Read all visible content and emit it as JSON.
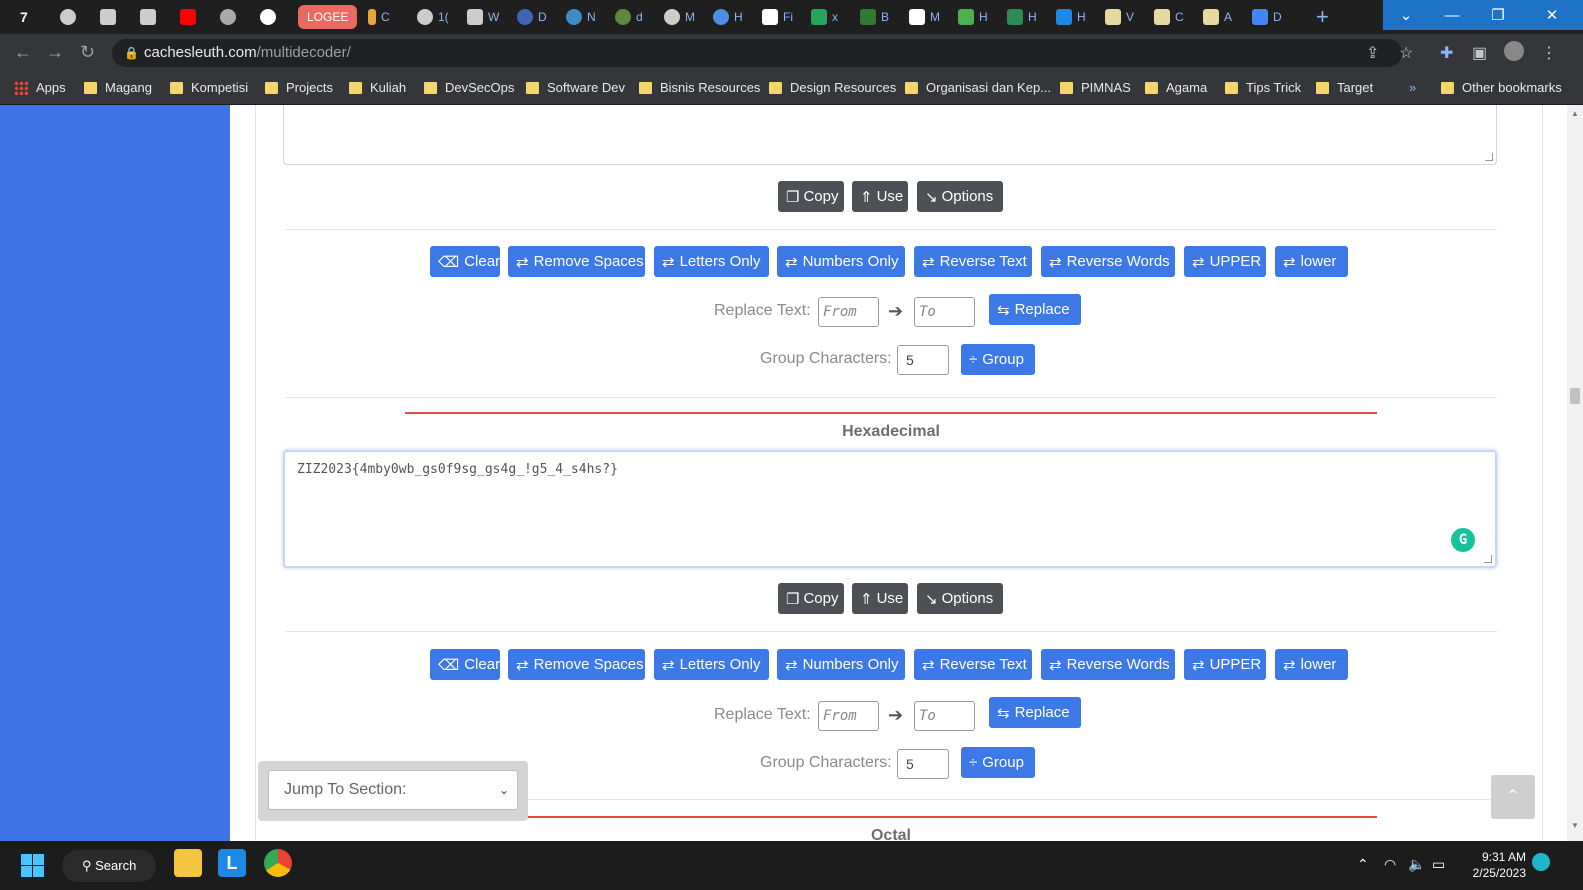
{
  "browser": {
    "tabs": [
      {
        "label": "7",
        "color": "#ffffff"
      },
      {
        "label": "",
        "color": "#cccccc"
      },
      {
        "label": "",
        "color": "#cccccc"
      },
      {
        "label": "",
        "color": "#cccccc"
      },
      {
        "label": "",
        "color": "#ff0000"
      },
      {
        "label": "",
        "color": "#aaaaaa"
      },
      {
        "label": "",
        "color": "#ffffff"
      },
      {
        "label": "LOGEE",
        "color": "#e96a61"
      },
      {
        "label": "C",
        "color": "#e8a33d"
      },
      {
        "label": "1(",
        "color": "#cccccc"
      },
      {
        "label": "W",
        "color": "#cccccc"
      },
      {
        "label": "D",
        "color": "#3c66b4"
      },
      {
        "label": "N",
        "color": "#3c8ccb"
      },
      {
        "label": "d",
        "color": "#5b8a3a"
      },
      {
        "label": "M",
        "color": "#cccccc"
      },
      {
        "label": "H",
        "color": "#4a90e2"
      },
      {
        "label": "Fi",
        "color": "#ffffff"
      },
      {
        "label": "x",
        "color": "#26a65b"
      },
      {
        "label": "B",
        "color": "#2e7d32"
      },
      {
        "label": "M",
        "color": "#ffffff"
      },
      {
        "label": "H",
        "color": "#4caf50"
      },
      {
        "label": "H",
        "color": "#2e8b57"
      },
      {
        "label": "H",
        "color": "#1e88e5"
      },
      {
        "label": "V",
        "color": "#e8d9a0"
      },
      {
        "label": "C",
        "color": "#e8d9a0"
      },
      {
        "label": "A",
        "color": "#e8d9a0"
      },
      {
        "label": "D",
        "color": "#4285f4"
      }
    ],
    "url_domain": "cachesleuth.com",
    "url_path": "/multidecoder/",
    "bookmarks": [
      "Apps",
      "Magang",
      "Kompetisi",
      "Projects",
      "Kuliah",
      "DevSecOps",
      "Software Dev",
      "Bisnis Resources",
      "Design Resources",
      "Organisasi dan Kep...",
      "PIMNAS",
      "Agama",
      "Tips Trick",
      "Target"
    ],
    "more_bookmarks": "»",
    "other_bookmarks": "Other bookmarks"
  },
  "toolbar1": {
    "copy": "Copy",
    "use": "Use",
    "options": "Options"
  },
  "actions": [
    "Clear",
    "Remove Spaces",
    "Letters Only",
    "Numbers Only",
    "Reverse Text",
    "Reverse Words",
    "UPPER",
    "lower"
  ],
  "replace": {
    "label": "Replace Text:",
    "from_placeholder": "From",
    "to_placeholder": "To",
    "button": "Replace"
  },
  "group": {
    "label": "Group Characters:",
    "value": "5",
    "button": "Group"
  },
  "hex_section": {
    "title": "Hexadecimal",
    "value": "ZIZ2023{4mby0wb_gs0f9sg_gs4g_!g5_4_s4hs?}"
  },
  "next_section_title": "Octal",
  "jump": {
    "label": "Jump To Section:"
  },
  "taskbar": {
    "search": "Search",
    "time": "9:31 AM",
    "date": "2/25/2023"
  }
}
